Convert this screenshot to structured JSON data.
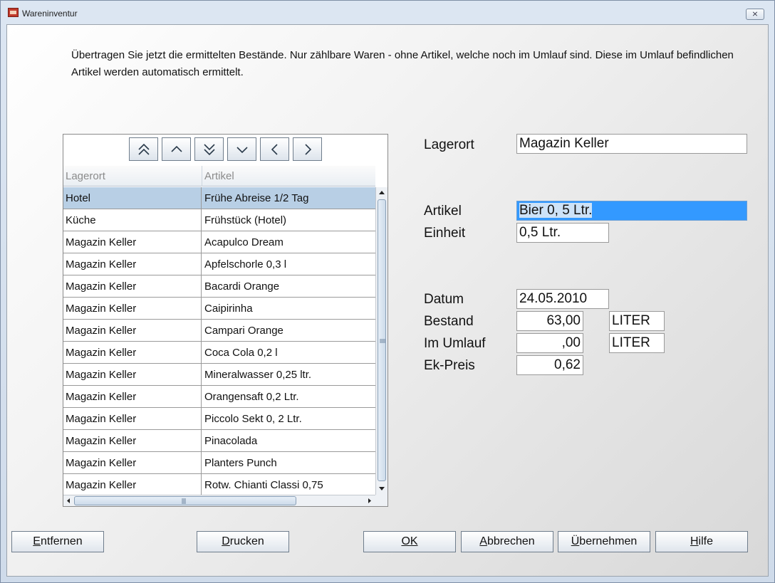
{
  "window": {
    "title": "Wareninventur",
    "close_glyph": "⨯"
  },
  "instruction": "Übertragen Sie jetzt die ermittelten Bestände. Nur zählbare Waren - ohne Artikel, welche noch im Umlauf sind. Diese im Umlauf befindlichen Artikel werden automatisch ermittelt.",
  "nav_buttons": [
    {
      "name": "first-page-button",
      "icon": "double-chevron-up-icon"
    },
    {
      "name": "previous-button",
      "icon": "chevron-up-icon"
    },
    {
      "name": "last-page-button",
      "icon": "double-chevron-down-icon"
    },
    {
      "name": "next-button",
      "icon": "chevron-down-icon"
    },
    {
      "name": "scroll-left-button",
      "icon": "chevron-left-icon"
    },
    {
      "name": "scroll-right-button",
      "icon": "chevron-right-icon"
    }
  ],
  "table": {
    "columns": [
      "Lagerort",
      "Artikel"
    ],
    "rows": [
      [
        "Hotel",
        "Frühe Abreise 1/2 Tag"
      ],
      [
        "Küche",
        "Frühstück (Hotel)"
      ],
      [
        "Magazin Keller",
        "Acapulco Dream"
      ],
      [
        "Magazin Keller",
        "Apfelschorle 0,3 l"
      ],
      [
        "Magazin Keller",
        "Bacardi Orange"
      ],
      [
        "Magazin Keller",
        "Caipirinha"
      ],
      [
        "Magazin Keller",
        "Campari Orange"
      ],
      [
        "Magazin Keller",
        "Coca Cola 0,2 l"
      ],
      [
        "Magazin Keller",
        "Mineralwasser 0,25 ltr."
      ],
      [
        "Magazin Keller",
        "Orangensaft 0,2 Ltr."
      ],
      [
        "Magazin Keller",
        "Piccolo Sekt 0, 2 Ltr."
      ],
      [
        "Magazin Keller",
        "Pinacolada"
      ],
      [
        "Magazin Keller",
        "Planters Punch"
      ],
      [
        "Magazin Keller",
        "Rotw. Chianti Classi 0,75"
      ]
    ],
    "selected_row": 0
  },
  "form": {
    "lagerort_label": "Lagerort",
    "lagerort_value": "Magazin Keller",
    "artikel_label": "Artikel",
    "artikel_value": "Bier 0, 5 Ltr.",
    "einheit_label": "Einheit",
    "einheit_value": "0,5 Ltr.",
    "datum_label": "Datum",
    "datum_value": "24.05.2010",
    "bestand_label": "Bestand",
    "bestand_value": "63,00",
    "bestand_unit": "LITER",
    "umlauf_label": "Im Umlauf",
    "umlauf_value": ",00",
    "umlauf_unit": "LITER",
    "preis_label": "Ek-Preis",
    "preis_value": "0,62"
  },
  "buttons": {
    "entfernen": {
      "mnemonic": "E",
      "rest": "ntfernen"
    },
    "drucken": {
      "mnemonic": "D",
      "rest": "rucken"
    },
    "ok": {
      "mnemonic": "O",
      "rest": "K"
    },
    "abbrechen": {
      "mnemonic": "A",
      "rest": "bbrechen"
    },
    "uebernehmen": {
      "mnemonic": "Ü",
      "rest": "bernehmen"
    },
    "hilfe": {
      "mnemonic": "H",
      "rest": "ilfe"
    }
  }
}
